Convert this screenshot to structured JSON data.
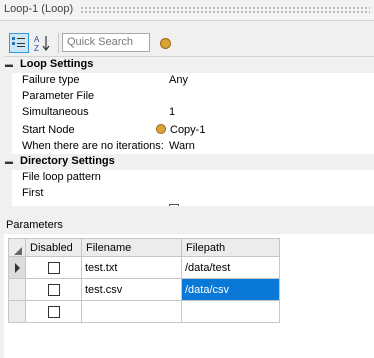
{
  "window": {
    "title": "Loop-1 (Loop)"
  },
  "toolbar": {
    "categorized_icon": "categorized-view-icon",
    "alphabetical_icon": "sort-az-icon",
    "search_placeholder": "Quick Search",
    "help_icon": "help-icon"
  },
  "propgrid": {
    "loop_settings": {
      "label": "Loop Settings",
      "failure_type": {
        "name": "Failure type",
        "value": "Any"
      },
      "parameter_file": {
        "name": "Parameter File",
        "value": ""
      },
      "simultaneous": {
        "name": "Simultaneous",
        "value": "1"
      },
      "start_node": {
        "name": "Start Node",
        "value": "Copy-1"
      },
      "no_iterations": {
        "name": "When there are no iterations:",
        "value": "Warn"
      }
    },
    "directory_settings": {
      "label": "Directory Settings",
      "file_loop_pattern": {
        "name": "File loop pattern",
        "value": ""
      },
      "first": {
        "name": "First",
        "value": ""
      }
    }
  },
  "parameters": {
    "label": "Parameters",
    "columns": [
      "Disabled",
      "Filename",
      "Filepath"
    ],
    "rows": [
      {
        "filename": "test.txt",
        "filepath": "/data/test"
      },
      {
        "filename": "test.csv",
        "filepath": "/data/csv"
      },
      {
        "filename": "",
        "filepath": ""
      }
    ]
  }
}
